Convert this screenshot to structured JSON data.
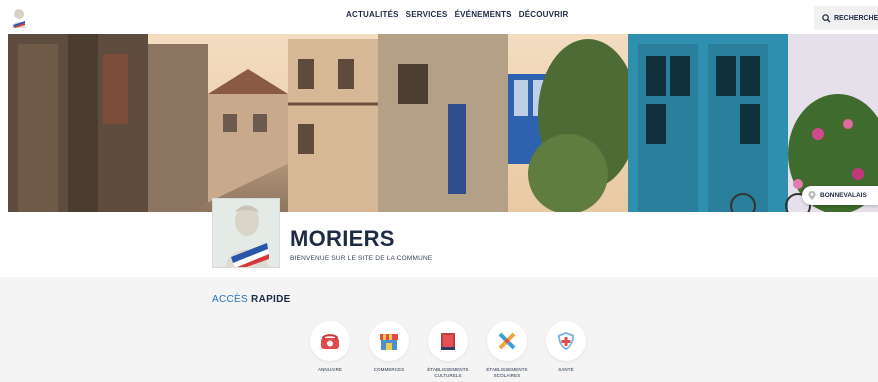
{
  "header": {
    "logo_icon": "marianne-logo-icon",
    "nav": [
      "ACTUALITÉS",
      "SERVICES",
      "ÉVÉNEMENTS",
      "DÉCOUVRIR"
    ],
    "search_label": "RECHERCHE"
  },
  "hero": {
    "location_label": "BONNEVALAIS"
  },
  "identity": {
    "town_name": "MORIERS",
    "tagline": "BIENVENUE SUR LE SITE DE LA COMMUNE"
  },
  "quick_access": {
    "title_prefix": "ACCÈS",
    "title_bold": "RAPIDE",
    "tiles": [
      {
        "label": "ANNUAIRE",
        "icon": "phone-icon"
      },
      {
        "label": "COMMERCES",
        "icon": "shop-icon"
      },
      {
        "label": "ÉTABLISSEMENTS CULTURELS",
        "icon": "book-icon"
      },
      {
        "label": "ÉTABLISSEMENTS SCOLAIRES",
        "icon": "pencil-icon"
      },
      {
        "label": "SANTÉ",
        "icon": "health-shield-icon"
      }
    ]
  },
  "colors": {
    "navy": "#1d2b44",
    "accent_blue": "#2a76b8",
    "quick_bg": "#f4f4f4"
  }
}
